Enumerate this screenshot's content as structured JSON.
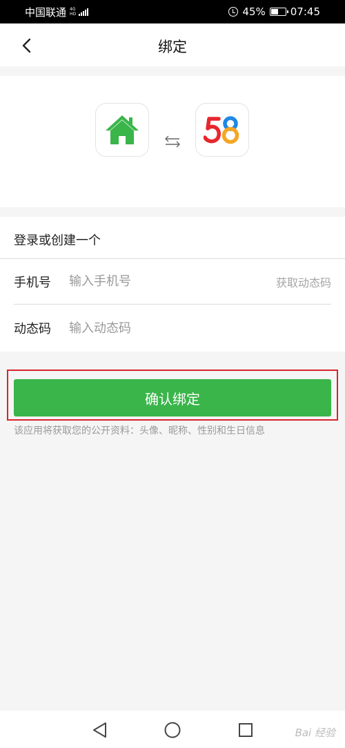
{
  "status_bar": {
    "carrier": "中国联通",
    "network_top": "4G",
    "network_bottom": "HD",
    "battery": "45%",
    "time": "07:45"
  },
  "nav": {
    "title": "绑定"
  },
  "logos": {
    "left_icon": "home-icon",
    "swap_icon": "swap-arrows-icon",
    "right_icon": "58-logo-icon",
    "right_label": "58",
    "colors": {
      "home_green": "#3ab54a",
      "five_color": "#e8262d",
      "eight_color": "#f5a623",
      "eight_blue": "#1e88e5"
    }
  },
  "form": {
    "section_title": "登录或创建一个",
    "phone_label": "手机号",
    "phone_placeholder": "输入手机号",
    "get_code": "获取动态码",
    "code_label": "动态码",
    "code_placeholder": "输入动态码"
  },
  "action": {
    "confirm_label": "确认绑定",
    "hint": "该应用将获取您的公开资料：头像、昵称、性别和生日信息",
    "accent": "#3ab54a",
    "highlight_color": "#d8232a"
  },
  "watermark": "Bai 经验"
}
